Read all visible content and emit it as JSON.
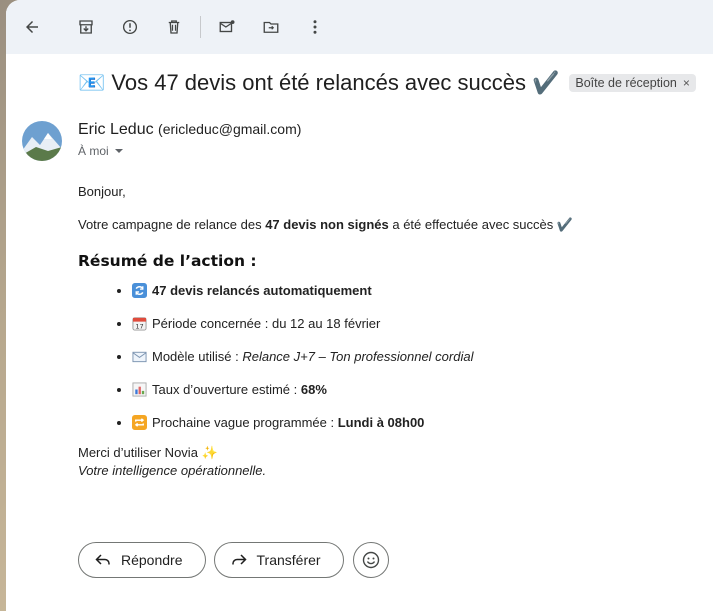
{
  "toolbar": {
    "icons": [
      "back-arrow-icon",
      "archive-icon",
      "report-spam-icon",
      "delete-icon",
      "mark-unread-icon",
      "move-to-icon",
      "more-vert-icon"
    ]
  },
  "email": {
    "subject_emoji": "📧",
    "subject": "Vos 47 devis ont été relancés avec succès",
    "subject_check": "✔️",
    "label": "Boîte de réception",
    "label_close": "×",
    "sender_name": "Eric Leduc",
    "sender_email": "(ericleduc@gmail.com)",
    "to_line": "À moi",
    "greeting": "Bonjour,",
    "intro_prefix": "Votre campagne de relance des ",
    "intro_bold": "47 devis non signés",
    "intro_suffix": " a été effectuée avec succès ",
    "summary_title": "Résumé de l’action :",
    "items": {
      "item1_bold": "47 devis relancés automatiquement",
      "item2_text": "Période concernée : du 12 au 18 février",
      "item3_prefix": "Modèle utilisé : ",
      "item3_italic": "Relance J+7 – Ton professionnel cordial",
      "item4_prefix": "Taux d’ouverture estimé : ",
      "item4_bold": "68%",
      "item5_prefix": "Prochaine vague programmée : ",
      "item5_bold": "Lundi à 08h00"
    },
    "thanks": "Merci d’utiliser Novia",
    "tagline": "Votre intelligence opérationnelle."
  },
  "actions": {
    "reply_label": "Répondre",
    "forward_label": "Transférer"
  }
}
